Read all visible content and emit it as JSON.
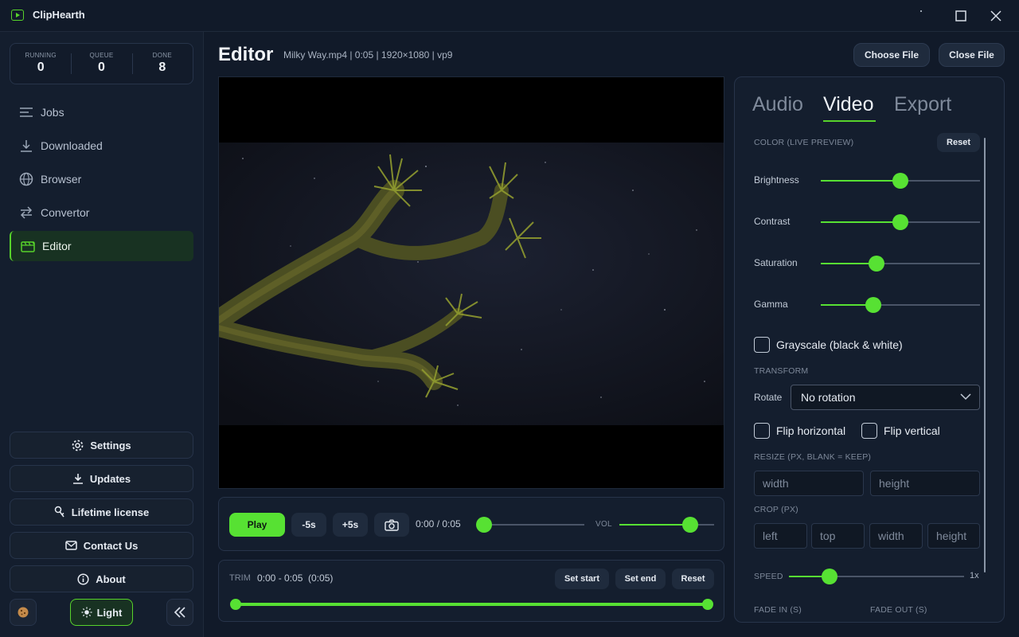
{
  "window": {
    "title": "ClipHearth",
    "icons": {
      "logo": "play-window-icon",
      "maximize": "maximize-icon",
      "close": "close-icon"
    }
  },
  "stats": [
    {
      "label": "RUNNING",
      "value": "0"
    },
    {
      "label": "QUEUE",
      "value": "0"
    },
    {
      "label": "DONE",
      "value": "8"
    }
  ],
  "nav": [
    {
      "label": "Jobs",
      "icon": "list-icon"
    },
    {
      "label": "Downloaded",
      "icon": "download-icon"
    },
    {
      "label": "Browser",
      "icon": "globe-icon"
    },
    {
      "label": "Convertor",
      "icon": "swap-icon"
    },
    {
      "label": "Editor",
      "icon": "clapper-icon",
      "active": true
    }
  ],
  "sidebar_buttons": {
    "settings": "Settings",
    "updates": "Updates",
    "license": "Lifetime license",
    "contact": "Contact Us",
    "about": "About",
    "theme": "Light"
  },
  "header": {
    "title": "Editor",
    "meta": "Milky Way.mp4 | 0:05 | 1920×1080 | vp9",
    "choose_file": "Choose File",
    "close_file": "Close File"
  },
  "controls": {
    "play": "Play",
    "back": "-5s",
    "forward": "+5s",
    "time": "0:00 / 0:05",
    "vol_label": "VOL",
    "progress": 0.0,
    "volume": 0.75
  },
  "trim": {
    "label": "TRIM",
    "range": "0:00 - 0:05  (0:05)",
    "set_start": "Set start",
    "set_end": "Set end",
    "reset": "Reset"
  },
  "panel": {
    "tabs": [
      "Audio",
      "Video",
      "Export"
    ],
    "active_tab": "Video",
    "color_section": "COLOR (LIVE PREVIEW)",
    "reset": "Reset",
    "sliders": [
      {
        "label": "Brightness",
        "value": 0.5
      },
      {
        "label": "Contrast",
        "value": 0.5
      },
      {
        "label": "Saturation",
        "value": 0.35
      },
      {
        "label": "Gamma",
        "value": 0.33
      }
    ],
    "grayscale": "Grayscale (black & white)",
    "transform_section": "TRANSFORM",
    "rotate_label": "Rotate",
    "rotate_value": "No rotation",
    "flip_h": "Flip horizontal",
    "flip_v": "Flip vertical",
    "resize_section": "RESIZE (PX, BLANK = KEEP)",
    "resize_width_ph": "width",
    "resize_height_ph": "height",
    "crop_section": "CROP (PX)",
    "crop_left_ph": "left",
    "crop_top_ph": "top",
    "crop_width_ph": "width",
    "crop_height_ph": "height",
    "speed_label": "SPEED",
    "speed_value": "1x",
    "speed_level": 0.23,
    "fade_in": "FADE IN (S)",
    "fade_out": "FADE OUT (S)"
  },
  "colors": {
    "accent": "#57e133",
    "bg": "#111a29",
    "panel": "#141e2e"
  }
}
